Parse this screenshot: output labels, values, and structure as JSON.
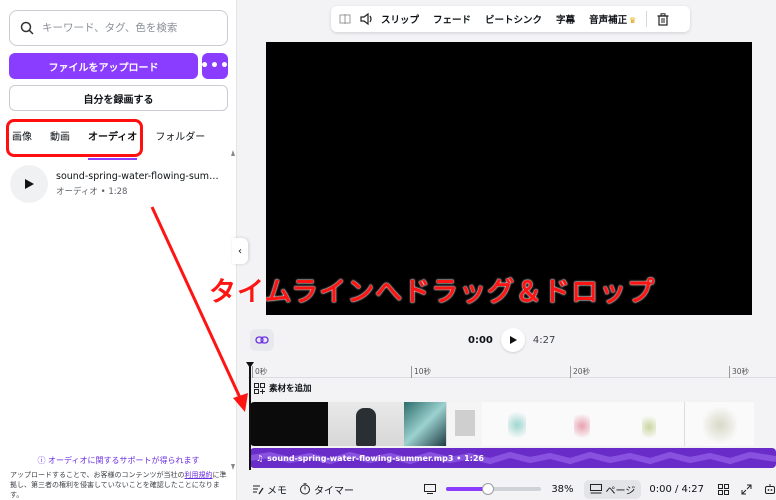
{
  "sidebar": {
    "search_placeholder": "キーワード、タグ、色を検索",
    "upload_label": "ファイルをアップロード",
    "more_label": "•••",
    "record_label": "自分を録画する",
    "tabs": [
      {
        "label": "画像",
        "active": false
      },
      {
        "label": "動画",
        "active": false
      },
      {
        "label": "オーディオ",
        "active": true
      },
      {
        "label": "フォルダー",
        "active": false
      }
    ],
    "audio_item": {
      "name": "sound-spring-water-flowing-summ...",
      "subtitle": "オーディオ • 1:28"
    },
    "support_link": "オーディオに関するサポートが得られます",
    "legal_pre": "アップロードすることで、お客様のコンテンツが当社の",
    "legal_link": "利用規約",
    "legal_post": "に準拠し、第三者の権利を侵害していないことを確認したことになります。"
  },
  "toolbar": {
    "items": [
      "スリップ",
      "フェード",
      "ビートシンク",
      "字幕",
      "音声補正"
    ]
  },
  "overlay_caption": "タイムラインへドラッグ＆ドロップ",
  "playback": {
    "current": "0:00",
    "total": "4:27"
  },
  "timeline": {
    "ticks": [
      "0秒",
      "10秒",
      "20秒",
      "30秒"
    ],
    "add_material": "素材を追加",
    "audio_track_label": "sound-spring-water-flowing-summer.mp3 • 1:26"
  },
  "bottom_bar": {
    "memo": "メモ",
    "timer": "タイマー",
    "zoom": "38%",
    "zoom_level": 0.38,
    "pages": "ページ",
    "time": "0:00 / 4:27"
  },
  "colors": {
    "accent": "#8b3dff",
    "annotation_red": "#ff1414",
    "audio_track": "#6a2cc8"
  }
}
